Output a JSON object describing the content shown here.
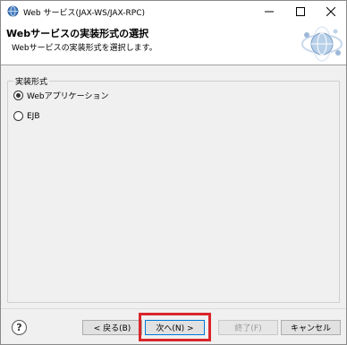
{
  "window": {
    "title": "Web サービス(JAX-WS/JAX-RPC)"
  },
  "banner": {
    "title": "Webサービスの実装形式の選択",
    "description": "Webサービスの実装形式を選択します。"
  },
  "group": {
    "label": "実装形式",
    "options": [
      {
        "label": "Webアプリケーション",
        "checked": true
      },
      {
        "label": "EJB",
        "checked": false
      }
    ]
  },
  "footer": {
    "help_glyph": "?",
    "back_label": "< 戻る(B)",
    "next_label": "次へ(N) >",
    "finish_label": "終了(F)",
    "cancel_label": "キャンセル"
  },
  "colors": {
    "highlight": "#d9262b",
    "default_border": "#0078d7"
  }
}
